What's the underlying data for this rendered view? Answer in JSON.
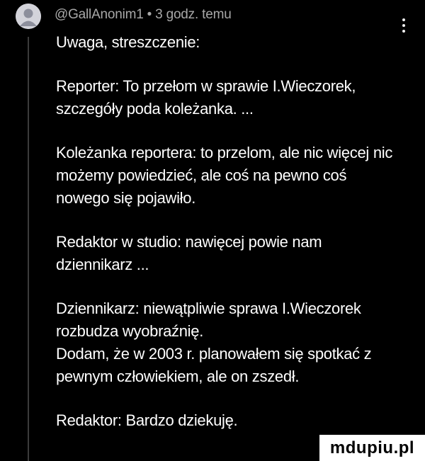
{
  "post": {
    "username": "@GallAnonim1",
    "separator": "•",
    "timestamp": "3 godz. temu",
    "lines": [
      "Uwaga, streszczenie:",
      "",
      "Reporter: To przełom w sprawie I.Wieczorek,",
      "szczegóły poda koleżanka. ...",
      "",
      "Koleżanka reportera: to przelom, ale nic więcej nic",
      "możemy powiedzieć, ale coś na pewno coś",
      "nowego się pojawiło.",
      "",
      "Redaktor w studio: nawięcej powie nam",
      "dziennikarz ...",
      "",
      "Dziennikarz: niewątpliwie sprawa I.Wieczorek",
      "rozbudza wyobraźnię.",
      "Dodam, że w 2003 r. planowałem się spotkać z",
      "pewnym człowiekiem, ale on zszedł.",
      "",
      "Redaktor: Bardzo dziekuję."
    ]
  },
  "icons": {
    "avatar": "default-user-avatar",
    "menu": "kebab-menu-icon"
  },
  "watermark": {
    "text": "mdupiu.pl"
  },
  "colors": {
    "background": "#000000",
    "text": "#ffffff",
    "meta": "#a8a8a8"
  }
}
